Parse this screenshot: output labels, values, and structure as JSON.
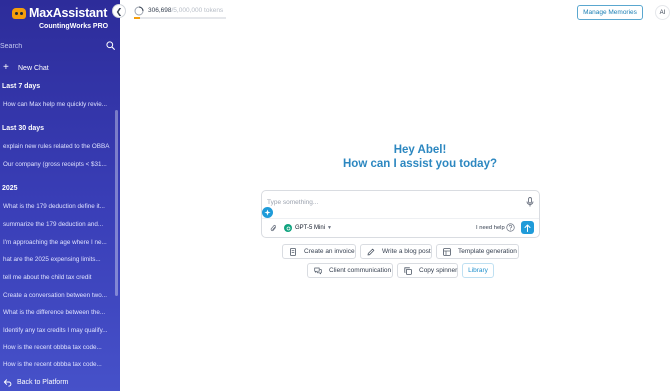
{
  "sidebar": {
    "brand_name": "MaxAssistant",
    "brand_sub": "CountingWorks PRO",
    "search_placeholder": "Search",
    "new_chat_label": "New Chat",
    "back_label": "Back to Platform",
    "sections": [
      {
        "title": "Last 7 days",
        "items": [
          "How can Max help me quickly revie..."
        ]
      },
      {
        "title": "Last 30 days",
        "items": [
          "explain new rules related to the OBBA",
          "Our company (gross receipts < $31..."
        ]
      },
      {
        "title": "2025",
        "items": [
          "What is the 179 deduction define it...",
          "summarize the 179 deduction and...",
          "I'm approaching the age where I ne...",
          "hat are the 2025 expensing limits...",
          "tell me about the child tax credit",
          "Create a conversation between two...",
          "What is the difference between the...",
          "Identify any tax credits I may qualify...",
          "How is the recent obbba tax code...",
          "How is the recent obbba tax code..."
        ]
      }
    ]
  },
  "topbar": {
    "tokens_used": "306,698",
    "tokens_total": "/5,000,000 tokens",
    "token_progress_fraction": 0.061,
    "manage_memories_label": "Manage Memories",
    "avatar_initials": "AI"
  },
  "main": {
    "greeting_line1": "Hey Abel!",
    "greeting_line2": "How can I assist you today?",
    "prompt_placeholder": "Type something...",
    "model_name": "GPT-5 Mini",
    "need_help_label": "I need help",
    "chips": [
      {
        "label": "Create an invoice",
        "icon": "invoice-icon"
      },
      {
        "label": "Write a blog post",
        "icon": "pencil-icon"
      },
      {
        "label": "Template generation",
        "icon": "template-icon"
      },
      {
        "label": "Client communication",
        "icon": "chat-icon"
      },
      {
        "label": "Copy spinner",
        "icon": "copy-icon"
      },
      {
        "label": "Library",
        "icon": ""
      }
    ]
  },
  "colors": {
    "sidebar_top": "#2d2c9a",
    "sidebar_bottom": "#4651c9",
    "accent": "#2c87c0",
    "send_button": "#1f9bd9",
    "token_progress": "#f59e0b"
  }
}
